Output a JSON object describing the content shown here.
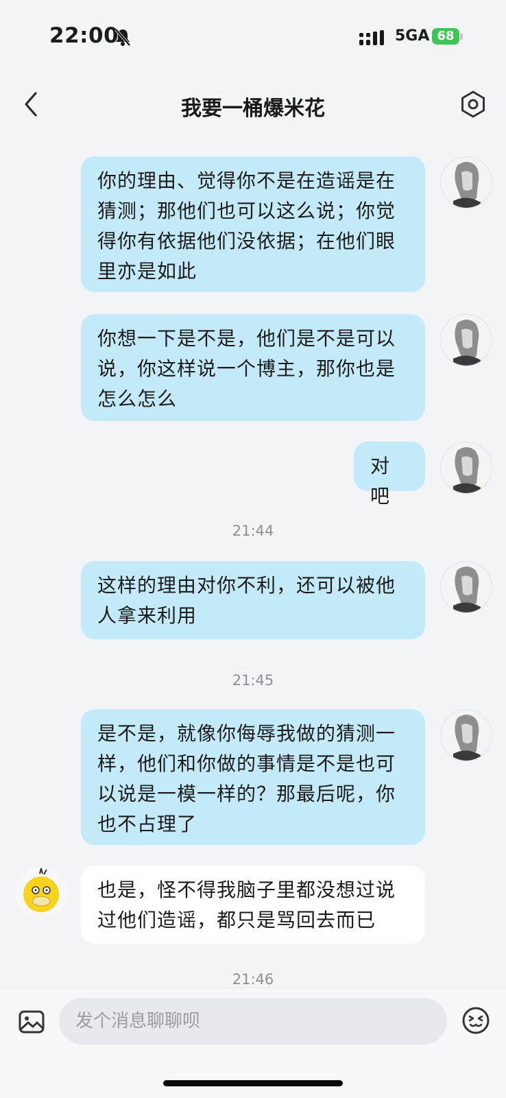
{
  "status_bar": {
    "time": "22:00",
    "network": "5GA",
    "battery": "68"
  },
  "header": {
    "title": "我要一桶爆米花"
  },
  "messages": [
    {
      "text": "你的理由、觉得你不是在造谣是在猜测；那他们也可以这么说；你觉得你有依据他们没依据；在他们眼里亦是如此"
    },
    {
      "text": "你想一下是不是，他们是不是可以说，你这样说一个博主，那你也是怎么怎么"
    },
    {
      "text": "对吧"
    },
    {
      "text": "这样的理由对你不利，还可以被他人拿来利用"
    },
    {
      "text": "是不是，就像你侮辱我做的猜测一样，他们和你做的事情是不是也可以说是一模一样的？那最后呢，你也不占理了"
    },
    {
      "text": "也是，怪不得我脑子里都没想过说过他们造谣，都只是骂回去而已"
    }
  ],
  "timestamps": [
    "21:44",
    "21:45",
    "21:46"
  ],
  "input": {
    "placeholder": "发个消息聊聊呗"
  },
  "colors": {
    "outgoing_bubble": "#c4eaf9",
    "incoming_bubble": "#ffffff",
    "background": "#f3f4f8",
    "battery": "#3ec55a"
  },
  "icons": [
    "mute-bell-icon",
    "signal-icon",
    "back-chevron-icon",
    "settings-hexagon-icon",
    "image-icon",
    "emoji-icon"
  ]
}
